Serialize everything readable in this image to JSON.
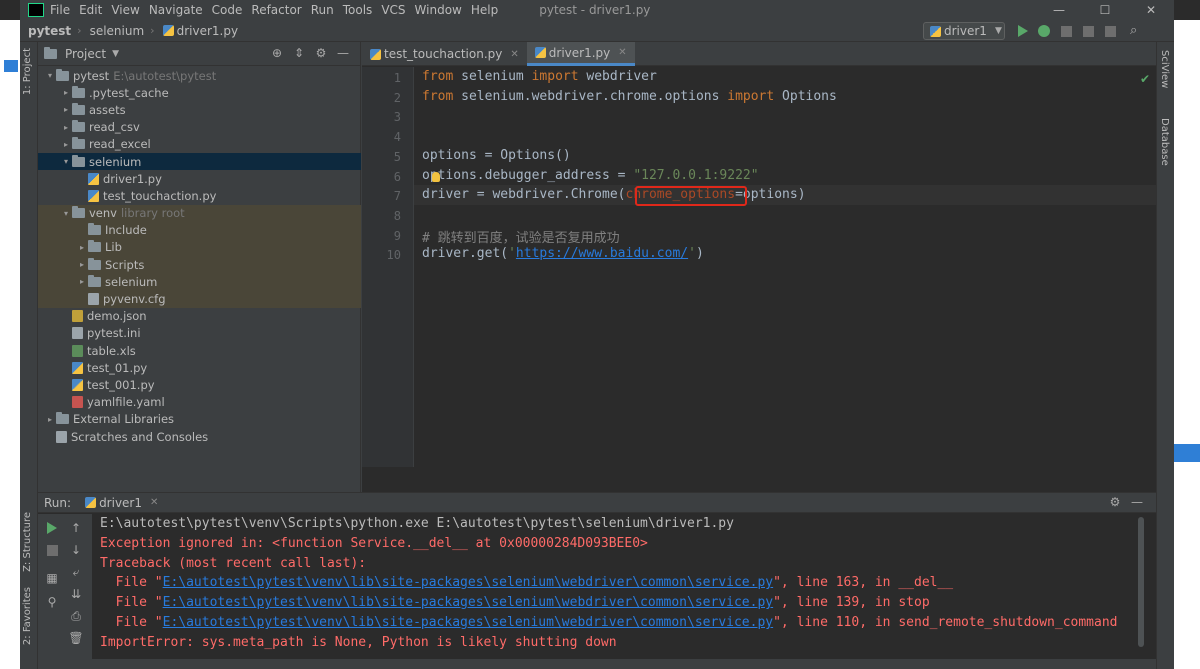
{
  "window": {
    "title": "pytest - driver1.py",
    "menu": [
      "File",
      "Edit",
      "View",
      "Navigate",
      "Code",
      "Refactor",
      "Run",
      "Tools",
      "VCS",
      "Window",
      "Help"
    ],
    "controls": [
      "—",
      "☐",
      "✕"
    ]
  },
  "navbar": {
    "project": "pytest",
    "folder": "selenium",
    "file": "driver1.py",
    "run_config": "driver1"
  },
  "left_strip": {
    "project_tab": "1: Project",
    "structure_tab": "Z: Structure",
    "favorites_tab": "2: Favorites"
  },
  "right_strip": {
    "sciview": "SciView",
    "database": "Database"
  },
  "project_panel": {
    "title": "Project",
    "tree": [
      {
        "label": "pytest",
        "extra": "E:\\autotest\\pytest",
        "depth": 0,
        "kind": "folder",
        "arrow": "▾"
      },
      {
        "label": ".pytest_cache",
        "depth": 1,
        "kind": "folder",
        "arrow": "▸"
      },
      {
        "label": "assets",
        "depth": 1,
        "kind": "folder",
        "arrow": "▸"
      },
      {
        "label": "read_csv",
        "depth": 1,
        "kind": "folder",
        "arrow": "▸"
      },
      {
        "label": "read_excel",
        "depth": 1,
        "kind": "folder",
        "arrow": "▸"
      },
      {
        "label": "selenium",
        "depth": 1,
        "kind": "folder",
        "arrow": "▾",
        "state": "selected"
      },
      {
        "label": "driver1.py",
        "depth": 2,
        "kind": "py",
        "arrow": ""
      },
      {
        "label": "test_touchaction.py",
        "depth": 2,
        "kind": "py",
        "arrow": ""
      },
      {
        "label": "venv",
        "extra": "library root",
        "depth": 1,
        "kind": "folder",
        "arrow": "▾",
        "state": "excluded"
      },
      {
        "label": "Include",
        "depth": 2,
        "kind": "folder",
        "arrow": "",
        "state": "excluded"
      },
      {
        "label": "Lib",
        "depth": 2,
        "kind": "folder",
        "arrow": "▸",
        "state": "excluded"
      },
      {
        "label": "Scripts",
        "depth": 2,
        "kind": "folder",
        "arrow": "▸",
        "state": "excluded"
      },
      {
        "label": "selenium",
        "depth": 2,
        "kind": "folder",
        "arrow": "▸",
        "state": "excluded"
      },
      {
        "label": "pyvenv.cfg",
        "depth": 2,
        "kind": "file",
        "arrow": "",
        "state": "excluded"
      },
      {
        "label": "demo.json",
        "depth": 1,
        "kind": "json",
        "arrow": ""
      },
      {
        "label": "pytest.ini",
        "depth": 1,
        "kind": "file",
        "arrow": ""
      },
      {
        "label": "table.xls",
        "depth": 1,
        "kind": "xls",
        "arrow": ""
      },
      {
        "label": "test_01.py",
        "depth": 1,
        "kind": "py",
        "arrow": ""
      },
      {
        "label": "test_001.py",
        "depth": 1,
        "kind": "py",
        "arrow": ""
      },
      {
        "label": "yamlfile.yaml",
        "depth": 1,
        "kind": "yaml",
        "arrow": ""
      },
      {
        "label": "External Libraries",
        "depth": 0,
        "kind": "folder",
        "arrow": "▸"
      },
      {
        "label": "Scratches and Consoles",
        "depth": 0,
        "kind": "file",
        "arrow": ""
      }
    ]
  },
  "editor": {
    "tabs": [
      {
        "label": "test_touchaction.py",
        "active": false
      },
      {
        "label": "driver1.py",
        "active": true
      }
    ],
    "line_numbers": [
      "1",
      "2",
      "3",
      "4",
      "5",
      "6",
      "7",
      "8",
      "9",
      "10"
    ],
    "lines": [
      [
        {
          "t": "from",
          "c": "kw"
        },
        {
          "t": " selenium ",
          "c": ""
        },
        {
          "t": "import",
          "c": "kw"
        },
        {
          "t": " webdriver",
          "c": ""
        }
      ],
      [
        {
          "t": "from",
          "c": "kw"
        },
        {
          "t": " selenium.webdriver.chrome.options ",
          "c": ""
        },
        {
          "t": "import",
          "c": "kw"
        },
        {
          "t": " Options",
          "c": ""
        }
      ],
      [],
      [],
      [
        {
          "t": "options = Options()",
          "c": ""
        }
      ],
      [
        {
          "t": "options.debugger_address = ",
          "c": ""
        },
        {
          "t": "\"127.0.0.1:9222\"",
          "c": "str"
        }
      ],
      [
        {
          "t": "driver = webdriver.Chrome(",
          "c": ""
        },
        {
          "t": "chrome_options",
          "c": "param"
        },
        {
          "t": "=options)",
          "c": ""
        }
      ],
      [],
      [
        {
          "t": "# 跳转到百度，试验是否复用成功",
          "c": "cmt"
        }
      ],
      [
        {
          "t": "driver.get(",
          "c": ""
        },
        {
          "t": "'",
          "c": "str"
        },
        {
          "t": "https://www.baidu.com/",
          "c": "url"
        },
        {
          "t": "'",
          "c": "str"
        },
        {
          "t": ")",
          "c": ""
        }
      ]
    ]
  },
  "run_panel": {
    "label": "Run:",
    "tab": "driver1",
    "output": [
      [
        {
          "t": "E:\\autotest\\pytest\\venv\\Scripts\\python.exe E:\\autotest\\pytest\\selenium\\driver1.py",
          "c": "norm"
        }
      ],
      [
        {
          "t": "Exception ignored in: <function Service.__del__ at 0x00000284D093BEE0>",
          "c": "err"
        }
      ],
      [
        {
          "t": "Traceback (most recent call last):",
          "c": "err"
        }
      ],
      [
        {
          "t": "  File \"",
          "c": "err"
        },
        {
          "t": "E:\\autotest\\pytest\\venv\\lib\\site-packages\\selenium\\webdriver\\common\\service.py",
          "c": "link"
        },
        {
          "t": "\", line 163, in __del__",
          "c": "err"
        }
      ],
      [
        {
          "t": "  File \"",
          "c": "err"
        },
        {
          "t": "E:\\autotest\\pytest\\venv\\lib\\site-packages\\selenium\\webdriver\\common\\service.py",
          "c": "link"
        },
        {
          "t": "\", line 139, in stop",
          "c": "err"
        }
      ],
      [
        {
          "t": "  File \"",
          "c": "err"
        },
        {
          "t": "E:\\autotest\\pytest\\venv\\lib\\site-packages\\selenium\\webdriver\\common\\service.py",
          "c": "link"
        },
        {
          "t": "\", line 110, in send_remote_shutdown_command",
          "c": "err"
        }
      ],
      [
        {
          "t": "ImportError: sys.meta_path is None, Python is likely shutting down",
          "c": "err"
        }
      ]
    ]
  }
}
